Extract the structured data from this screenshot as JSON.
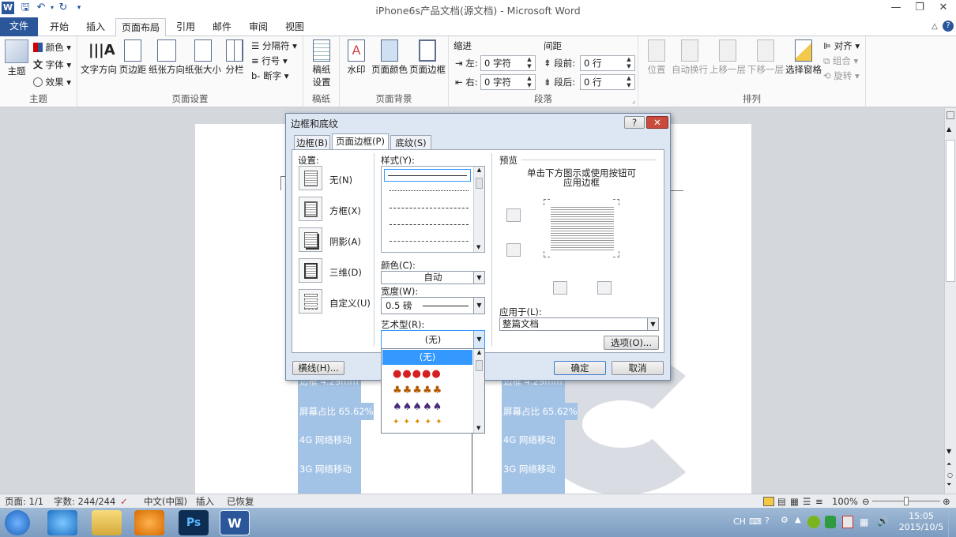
{
  "window": {
    "title": "iPhone6s产品文档(源文档) - Microsoft Word",
    "word_logo": "W"
  },
  "tabs": [
    "文件",
    "开始",
    "插入",
    "页面布局",
    "引用",
    "邮件",
    "审阅",
    "视图"
  ],
  "ribbon": {
    "theme": {
      "main": "主题",
      "color": "颜色",
      "font": "字体",
      "effect": "效果",
      "group": "主题"
    },
    "page_setup": {
      "text_dir": "文字方向",
      "margins": "页边距",
      "orientation": "纸张方向",
      "size": "纸张大小",
      "columns": "分栏",
      "breaks": "分隔符",
      "line_numbers": "行号",
      "hyphenation": "断字",
      "group": "页面设置"
    },
    "manuscript": {
      "label": "稿纸\n设置",
      "line1": "稿纸",
      "line2": "设置",
      "group": "稿纸"
    },
    "page_bg": {
      "watermark": "水印",
      "page_color": "页面颜色",
      "page_border": "页面边框",
      "group": "页面背景"
    },
    "paragraph": {
      "indent": "缩进",
      "spacing": "间距",
      "left": "左:",
      "right": "右:",
      "before": "段前:",
      "after": "段后:",
      "left_val": "0 字符",
      "right_val": "0 字符",
      "before_val": "0 行",
      "after_val": "0 行",
      "group": "段落"
    },
    "arrange": {
      "position": "位置",
      "wrap": "自动换行",
      "forward": "上移一层",
      "backward": "下移一层",
      "pane": "选择窗格",
      "align": "对齐",
      "group_btn": "组合",
      "rotate": "旋转",
      "group": "排列"
    }
  },
  "document": {
    "lines_left": [
      "边框 4.29mm",
      "屏幕占比 65.62%",
      "4G 网络移动",
      "3G 网络移动"
    ],
    "lines_right": [
      "边框 4.29mm",
      "屏幕占比 65.62%",
      "4G 网络移动",
      "3G 网络移动"
    ]
  },
  "dialog": {
    "title": "边框和底纹",
    "help": "?",
    "close": "✕",
    "tabs": [
      "边框(B)",
      "页面边框(P)",
      "底纹(S)"
    ],
    "settings_label": "设置:",
    "settings": [
      "无(N)",
      "方框(X)",
      "阴影(A)",
      "三维(D)",
      "自定义(U)"
    ],
    "style_label": "样式(Y):",
    "color_label": "颜色(C):",
    "color_value": "自动",
    "width_label": "宽度(W):",
    "width_value": "0.5 磅",
    "art_label": "艺术型(R):",
    "art_value": "(无)",
    "art_options": [
      "(无)"
    ],
    "preview_label": "预览",
    "preview_hint_1": "单击下方图示或使用按钮可",
    "preview_hint_2": "应用边框",
    "apply_label": "应用于(L):",
    "apply_value": "整篇文档",
    "options_btn": "选项(O)...",
    "hline_btn": "横线(H)...",
    "ok_btn": "确定",
    "cancel_btn": "取消"
  },
  "status": {
    "page": "页面: 1/1",
    "words": "字数: 244/244",
    "lang": "中文(中国)",
    "mode": "插入",
    "recovered": "已恢复",
    "zoom": "100%"
  },
  "taskbar": {
    "ime": "CH",
    "time": "15:05",
    "date": "2015/10/5"
  },
  "colors": {
    "file_tab": "#2b579a",
    "selection": "#3399ff",
    "highlight": "#a3c3e6"
  }
}
